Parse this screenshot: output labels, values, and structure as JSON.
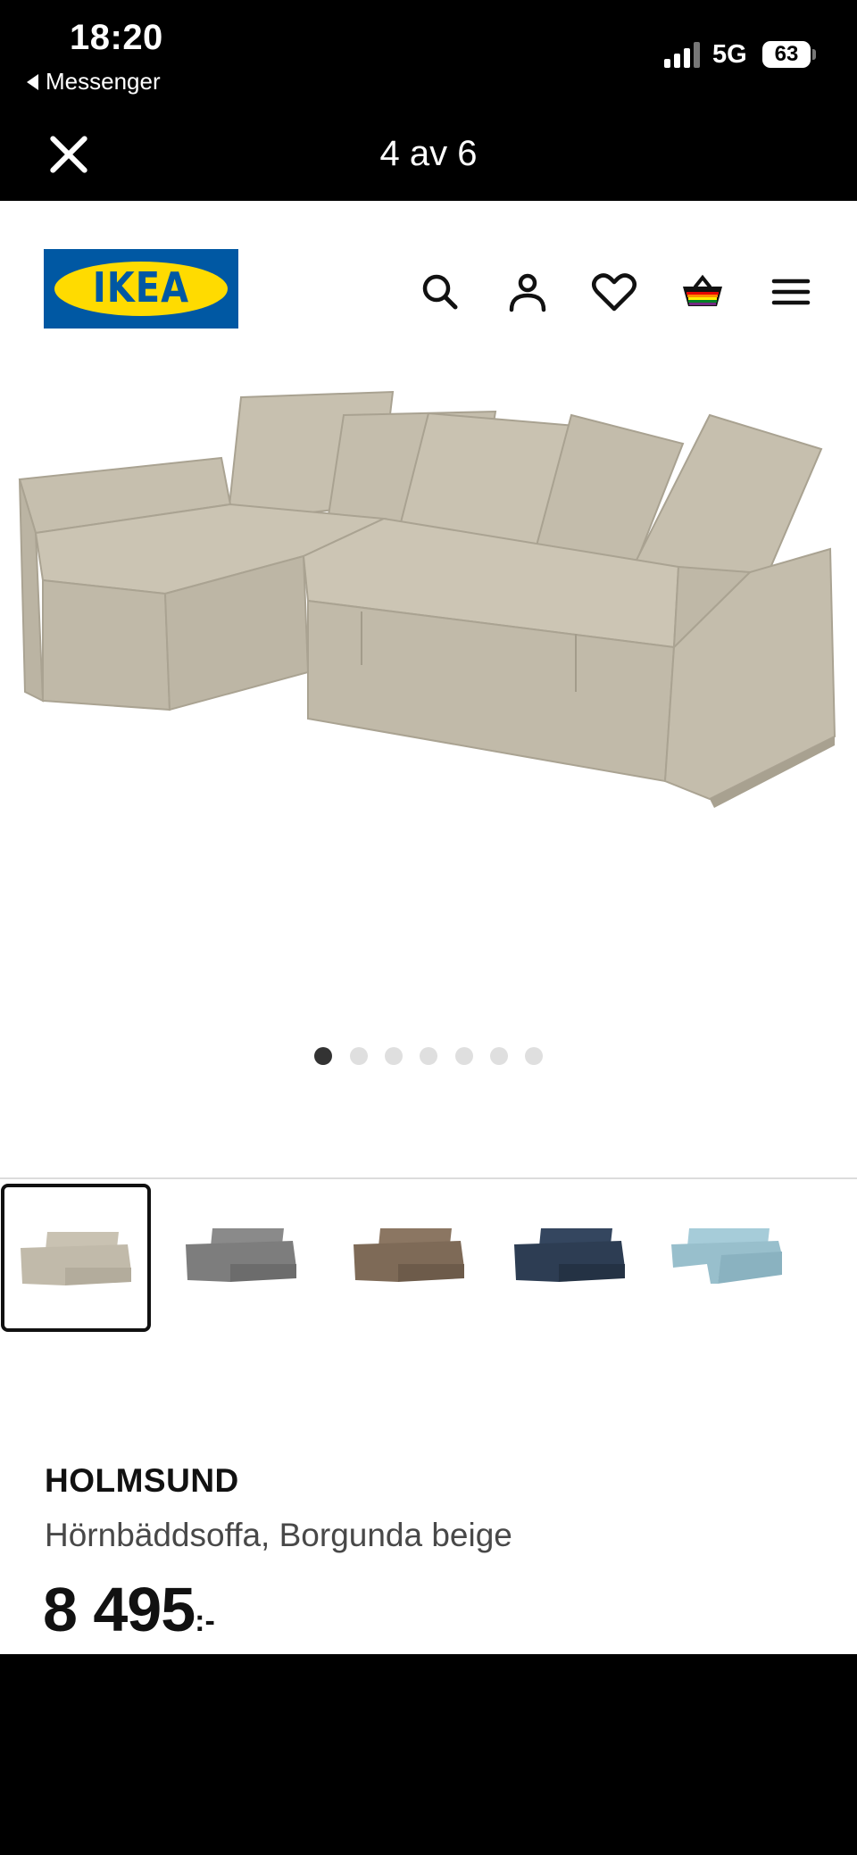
{
  "status_bar": {
    "time": "18:20",
    "back_app": "Messenger",
    "network": "5G",
    "battery": "63"
  },
  "viewer": {
    "counter": "4 av 6"
  },
  "header": {
    "logo_text": "IKEA",
    "icons": [
      "search-icon",
      "account-icon",
      "heart-icon",
      "basket-icon",
      "menu-icon"
    ],
    "colors": {
      "logo_blue": "#0058a3",
      "logo_yellow": "#ffdb00"
    }
  },
  "gallery": {
    "dots_total": 7,
    "active_dot": 1
  },
  "variants": [
    {
      "color": "#c9c2b2",
      "selected": true
    },
    {
      "color": "#8a8a8a",
      "selected": false
    },
    {
      "color": "#8b7662",
      "selected": false
    },
    {
      "color": "#34465f",
      "selected": false
    },
    {
      "color": "#a6ccd9",
      "selected": false
    }
  ],
  "product": {
    "name": "HOLMSUND",
    "description": "Hörnbäddsoffa, Borgunda beige",
    "price": "8 495",
    "price_suffix": ":-"
  }
}
